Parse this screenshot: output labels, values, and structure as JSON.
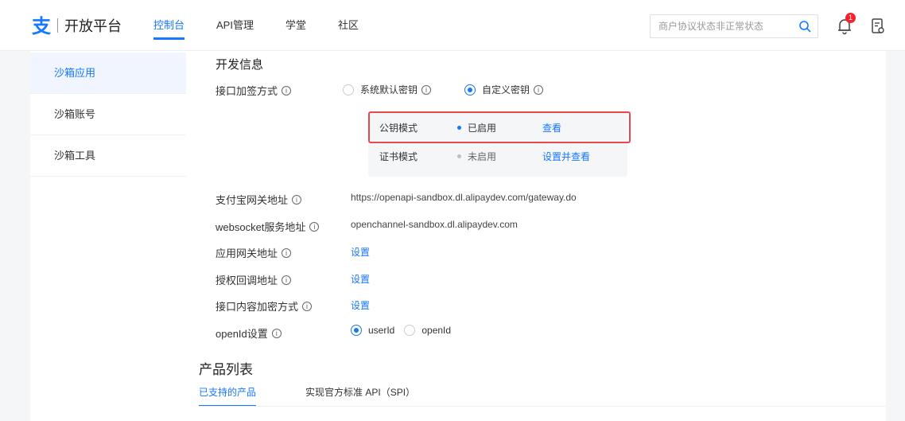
{
  "header": {
    "logo_glyph": "支",
    "logo_text": "开放平台",
    "nav": [
      "控制台",
      "API管理",
      "学堂",
      "社区"
    ],
    "search_placeholder": "商户协议状态非正常状态",
    "notification_count": "1"
  },
  "sidebar": {
    "items": [
      "沙箱应用",
      "沙箱账号",
      "沙箱工具"
    ]
  },
  "dev_info": {
    "title": "开发信息",
    "sign_label": "接口加签方式",
    "sign_options": [
      "系统默认密钥",
      "自定义密钥"
    ],
    "key_modes": [
      {
        "name": "公钥模式",
        "status": "已启用",
        "action": "查看"
      },
      {
        "name": "证书模式",
        "status": "未启用",
        "action": "设置并查看"
      }
    ],
    "gateway_label": "支付宝网关地址",
    "gateway_value": "https://openapi-sandbox.dl.alipaydev.com/gateway.do",
    "ws_label": "websocket服务地址",
    "ws_value": "openchannel-sandbox.dl.alipaydev.com",
    "app_gateway_label": "应用网关地址",
    "auth_callback_label": "授权回调地址",
    "encrypt_label": "接口内容加密方式",
    "set_link": "设置",
    "openid_label": "openId设置",
    "openid_options": [
      "userId",
      "openId"
    ]
  },
  "products": {
    "title": "产品列表",
    "tabs": [
      "已支持的产品",
      "实现官方标准 API（SPI）"
    ]
  },
  "colors": {
    "accent": "#1677ff",
    "highlight": "#e5484d",
    "badge": "#f5222d"
  }
}
